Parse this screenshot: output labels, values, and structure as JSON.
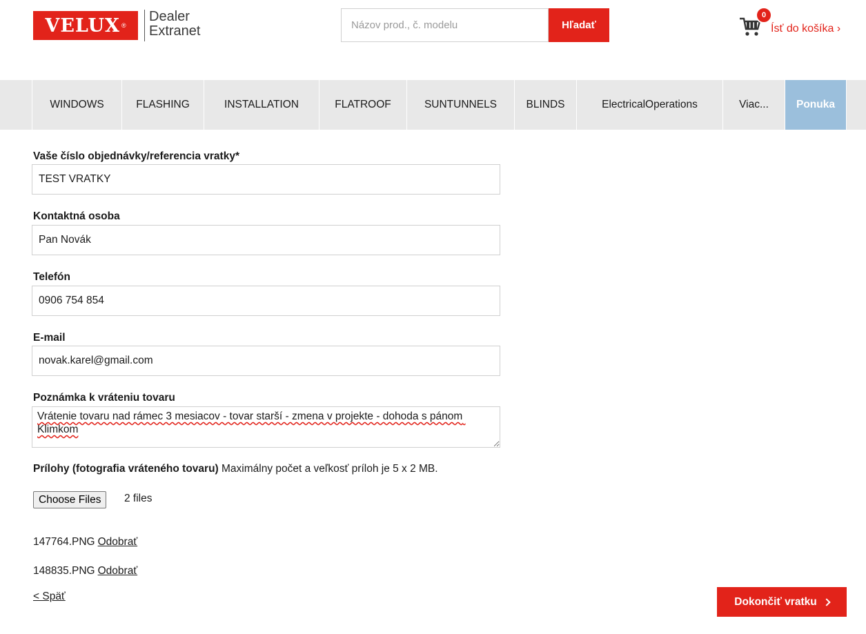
{
  "header": {
    "logo_text": "VELUX",
    "logo_mark": "®",
    "subtitle_line1": "Dealer",
    "subtitle_line2": "Extranet",
    "search_placeholder": "Názov prod., č. modelu",
    "search_button": "Hľadať",
    "cart_count": "0",
    "cart_label": "Ísť do košíka ›",
    "cart_icon": "shopping-cart-icon"
  },
  "nav": {
    "items": [
      {
        "label": "WINDOWS"
      },
      {
        "label": "FLASHING"
      },
      {
        "label": "INSTALLATION"
      },
      {
        "label": "FLATROOF"
      },
      {
        "label": "SUNTUNNELS"
      },
      {
        "label": "BLINDS"
      },
      {
        "label": "ElectricalOperations"
      },
      {
        "label": "Viac..."
      },
      {
        "label": "Ponuka"
      }
    ],
    "active_index": 8,
    "active_color": "#9bbfdc"
  },
  "form": {
    "order_ref": {
      "label": "Vaše číslo objednávky/referencia vratky*",
      "value": "TEST VRATKY"
    },
    "contact": {
      "label": "Kontaktná osoba",
      "value": "Pan Novák"
    },
    "phone": {
      "label": "Telefón",
      "value": "0906 754 854"
    },
    "email": {
      "label": "E-mail",
      "value": "novak.karel@gmail.com"
    },
    "note": {
      "label": "Poznámka k vráteniu tovaru",
      "value": "Vrátenie tovaru nad rámec 3 mesiacov - tovar starší - zmena v projekte - dohoda s pánom Klimkom"
    },
    "attachments": {
      "label_bold": "Prílohy (fotografia vráteného tovaru)",
      "label_rest": " Maximálny počet a veľkosť príloh je 5 x 2 MB.",
      "choose_button": "Choose Files",
      "file_count": "2 files",
      "files": [
        {
          "name": "147764.PNG",
          "remove": "Odobrať"
        },
        {
          "name": "148835.PNG",
          "remove": "Odobrať"
        }
      ]
    }
  },
  "footer": {
    "back_link": "< Späť",
    "finish_button": "Dokončiť vratku"
  },
  "colors": {
    "brand_red": "#e2231a",
    "nav_bg": "#e8e8e8"
  }
}
